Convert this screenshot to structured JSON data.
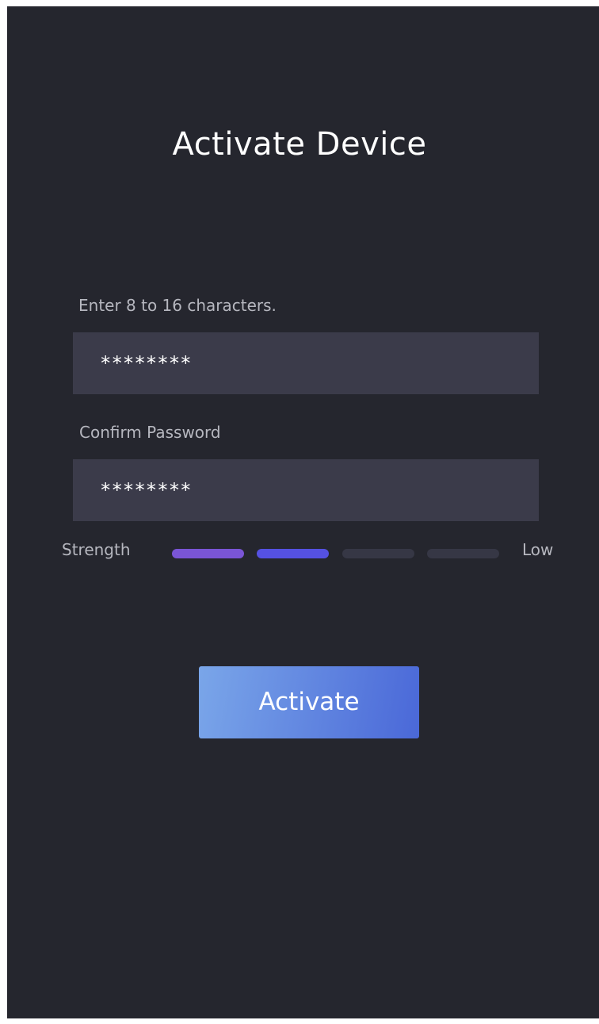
{
  "page": {
    "title": "Activate Device"
  },
  "form": {
    "password_hint": "Enter 8 to 16 characters.",
    "password_value": "********",
    "confirm_label": "Confirm Password",
    "confirm_value": "********"
  },
  "strength": {
    "label": "Strength",
    "value_label": "Low",
    "level": 2,
    "max_level": 4,
    "bar_colors": [
      "#7a55d6",
      "#5551e2",
      "#363745",
      "#363745"
    ]
  },
  "actions": {
    "activate_label": "Activate"
  },
  "colors": {
    "background": "#25262e",
    "field_background": "#3b3b4a",
    "button_gradient_start": "#7aa6e9",
    "button_gradient_end": "#4a68d8"
  }
}
